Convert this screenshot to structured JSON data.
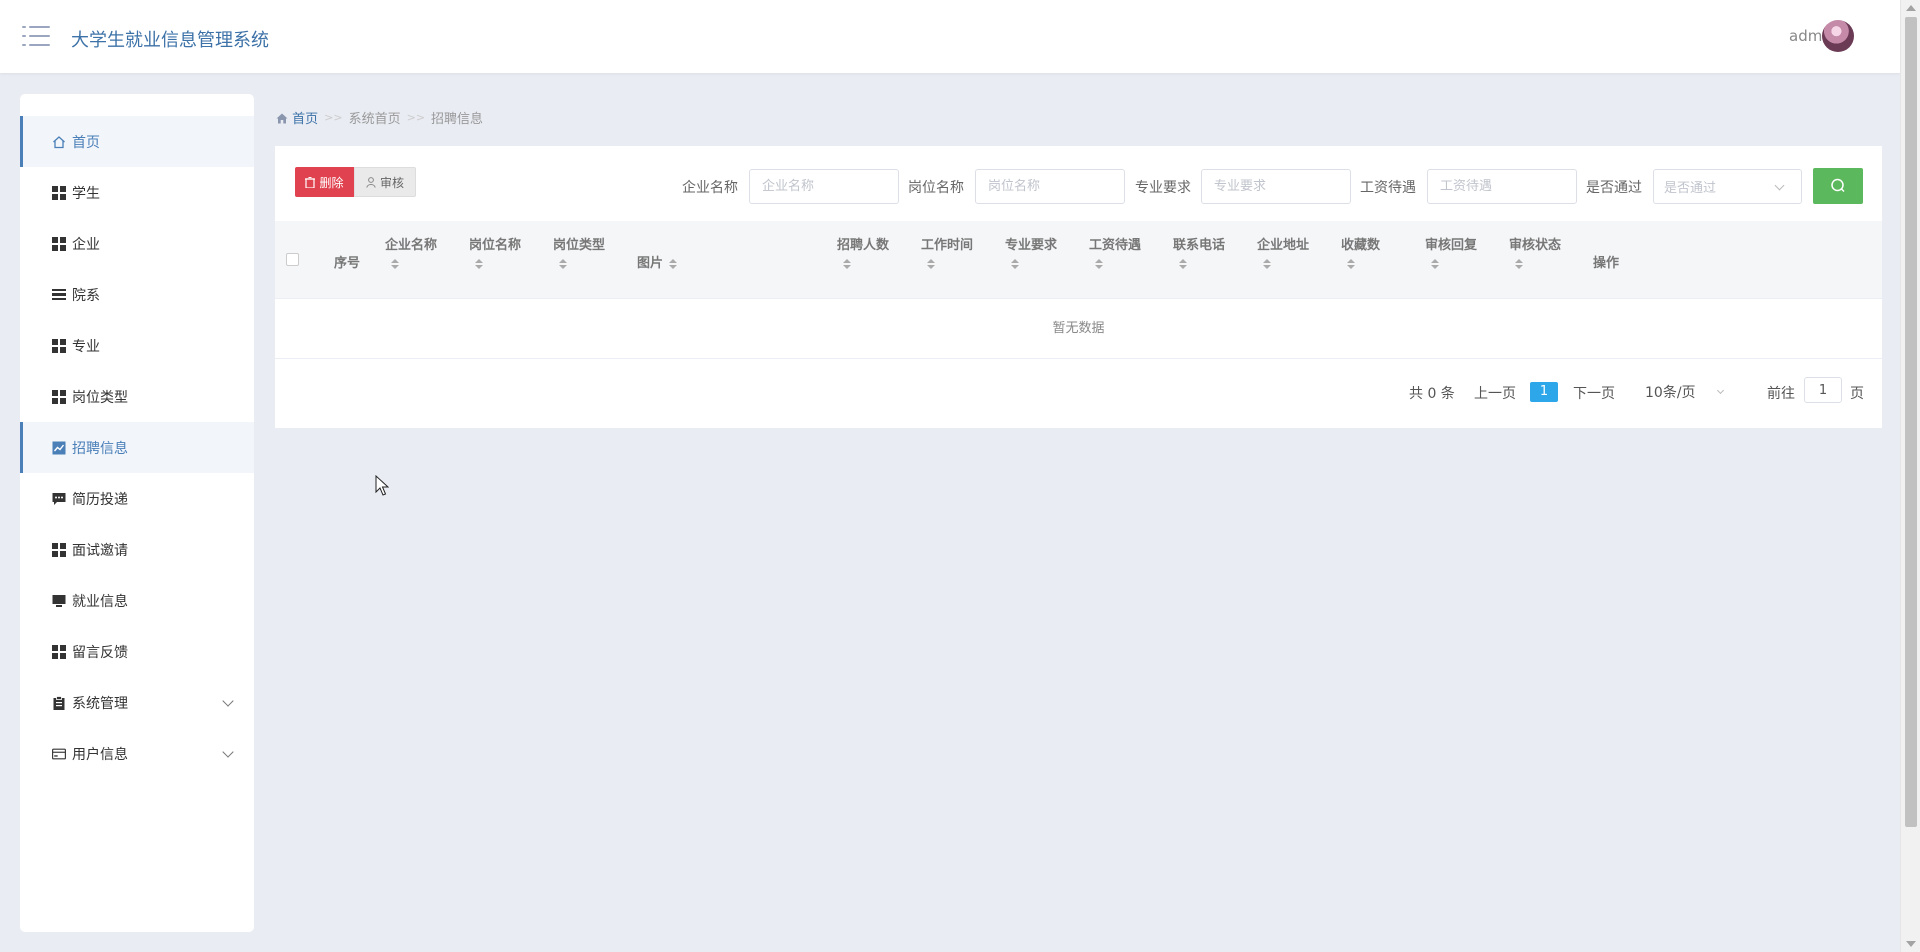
{
  "header": {
    "title": "大学生就业信息管理系统",
    "user": "admin"
  },
  "sidebar": {
    "items": [
      {
        "label": "首页",
        "icon": "home-icon",
        "active": true
      },
      {
        "label": "学生",
        "icon": "grid-icon"
      },
      {
        "label": "企业",
        "icon": "grid-icon"
      },
      {
        "label": "院系",
        "icon": "list-icon"
      },
      {
        "label": "专业",
        "icon": "grid-icon"
      },
      {
        "label": "岗位类型",
        "icon": "grid-icon"
      },
      {
        "label": "招聘信息",
        "icon": "chart-icon",
        "active": true
      },
      {
        "label": "简历投递",
        "icon": "comment-icon"
      },
      {
        "label": "面试邀请",
        "icon": "grid-icon"
      },
      {
        "label": "就业信息",
        "icon": "monitor-icon"
      },
      {
        "label": "留言反馈",
        "icon": "grid-icon"
      },
      {
        "label": "系统管理",
        "icon": "clipboard-icon",
        "expandable": true
      },
      {
        "label": "用户信息",
        "icon": "card-icon",
        "expandable": true
      }
    ]
  },
  "breadcrumb": {
    "home": "首页",
    "sep": ">>",
    "level1": "系统首页",
    "level2": "招聘信息"
  },
  "toolbar": {
    "delete_label": "删除",
    "audit_label": "审核"
  },
  "filters": {
    "company_label": "企业名称",
    "company_placeholder": "企业名称",
    "position_label": "岗位名称",
    "position_placeholder": "岗位名称",
    "major_label": "专业要求",
    "major_placeholder": "专业要求",
    "salary_label": "工资待遇",
    "salary_placeholder": "工资待遇",
    "passed_label": "是否通过",
    "passed_placeholder": "是否通过"
  },
  "table": {
    "columns": [
      "序号",
      "企业名称",
      "岗位名称",
      "岗位类型",
      "图片",
      "招聘人数",
      "工作时间",
      "专业要求",
      "工资待遇",
      "联系电话",
      "企业地址",
      "收藏数",
      "审核回复",
      "审核状态",
      "操作"
    ],
    "empty_text": "暂无数据"
  },
  "pagination": {
    "total_text": "共 0 条",
    "prev": "上一页",
    "current": "1",
    "next": "下一页",
    "page_size": "10条/页",
    "goto_prefix": "前往",
    "goto_value": "1",
    "goto_suffix": "页"
  },
  "colors": {
    "accent": "#3d72a8",
    "delete": "#e0434f",
    "search": "#5cb85c",
    "page_current": "#2ea7ea"
  }
}
